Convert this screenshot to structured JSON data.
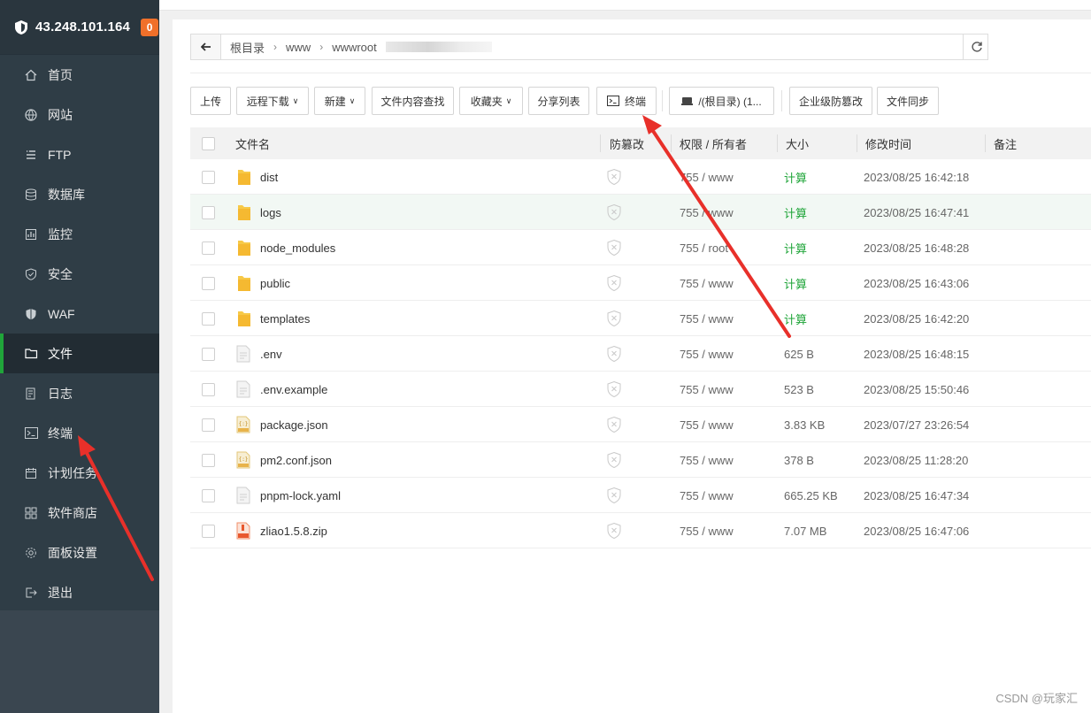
{
  "sidebar": {
    "server_ip": "43.248.101.164",
    "badge": "0",
    "items": [
      {
        "label": "首页",
        "icon": "home-icon"
      },
      {
        "label": "网站",
        "icon": "globe-icon"
      },
      {
        "label": "FTP",
        "icon": "ftp-icon"
      },
      {
        "label": "数据库",
        "icon": "database-icon"
      },
      {
        "label": "监控",
        "icon": "monitor-icon"
      },
      {
        "label": "安全",
        "icon": "shield-icon"
      },
      {
        "label": "WAF",
        "icon": "waf-icon"
      },
      {
        "label": "文件",
        "icon": "folder-icon",
        "active": true
      },
      {
        "label": "日志",
        "icon": "log-icon"
      },
      {
        "label": "终端",
        "icon": "terminal-icon"
      },
      {
        "label": "计划任务",
        "icon": "calendar-icon"
      },
      {
        "label": "软件商店",
        "icon": "apps-icon"
      },
      {
        "label": "面板设置",
        "icon": "gear-icon"
      },
      {
        "label": "退出",
        "icon": "logout-icon"
      }
    ]
  },
  "path": {
    "crumbs": [
      "根目录",
      "www",
      "wwwroot"
    ]
  },
  "toolbar": {
    "upload": "上传",
    "remote_download": "远程下载",
    "new": "新建",
    "content_search": "文件内容查找",
    "favorites": "收藏夹",
    "share_list": "分享列表",
    "terminal": "终端",
    "disk": "/(根目录) (1...",
    "tamper_proof": "企业级防篡改",
    "file_sync": "文件同步"
  },
  "table": {
    "headers": {
      "name": "文件名",
      "tamper": "防篡改",
      "perm": "权限 / 所有者",
      "size": "大小",
      "mtime": "修改时间",
      "note": "备注"
    },
    "rows": [
      {
        "name": "dist",
        "type": "folder",
        "perm": "755 / www",
        "size": "计算",
        "mtime": "2023/08/25 16:42:18"
      },
      {
        "name": "logs",
        "type": "folder",
        "perm": "755 / www",
        "size": "计算",
        "mtime": "2023/08/25 16:47:41"
      },
      {
        "name": "node_modules",
        "type": "folder",
        "perm": "755 / root",
        "size": "计算",
        "mtime": "2023/08/25 16:48:28"
      },
      {
        "name": "public",
        "type": "folder",
        "perm": "755 / www",
        "size": "计算",
        "mtime": "2023/08/25 16:43:06"
      },
      {
        "name": "templates",
        "type": "folder",
        "perm": "755 / www",
        "size": "计算",
        "mtime": "2023/08/25 16:42:20"
      },
      {
        "name": ".env",
        "type": "file",
        "perm": "755 / www",
        "size": "625 B",
        "mtime": "2023/08/25 16:48:15"
      },
      {
        "name": ".env.example",
        "type": "file",
        "perm": "755 / www",
        "size": "523 B",
        "mtime": "2023/08/25 15:50:46"
      },
      {
        "name": "package.json",
        "type": "json",
        "perm": "755 / www",
        "size": "3.83 KB",
        "mtime": "2023/07/27 23:26:54"
      },
      {
        "name": "pm2.conf.json",
        "type": "json",
        "perm": "755 / www",
        "size": "378 B",
        "mtime": "2023/08/25 11:28:20"
      },
      {
        "name": "pnpm-lock.yaml",
        "type": "file",
        "perm": "755 / www",
        "size": "665.25 KB",
        "mtime": "2023/08/25 16:47:34"
      },
      {
        "name": "zliao1.5.8.zip",
        "type": "zip",
        "perm": "755 / www",
        "size": "7.07 MB",
        "mtime": "2023/08/25 16:47:06"
      }
    ]
  },
  "watermark": "CSDN @玩家汇",
  "colors": {
    "sidebar_bg": "#2f3d46",
    "accent_green": "#20a53a",
    "badge_orange": "#f0702a",
    "arrow_red": "#e8302a"
  }
}
